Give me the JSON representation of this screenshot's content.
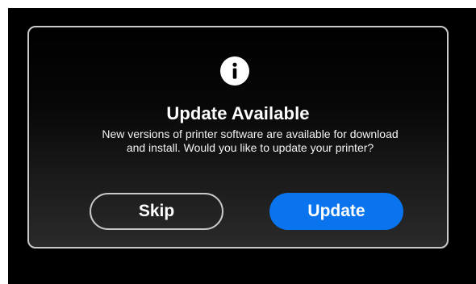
{
  "dialog": {
    "icon": "info-icon",
    "title": "Update Available",
    "message_line1": "New versions of printer software are available for download",
    "message_line2": "and install. Would you like to update your printer?",
    "skip_label": "Skip",
    "update_label": "Update"
  },
  "colors": {
    "screen_background": "#000000",
    "dialog_border": "#c9c9c9",
    "primary_button": "#0a74ee",
    "text": "#ffffff"
  }
}
